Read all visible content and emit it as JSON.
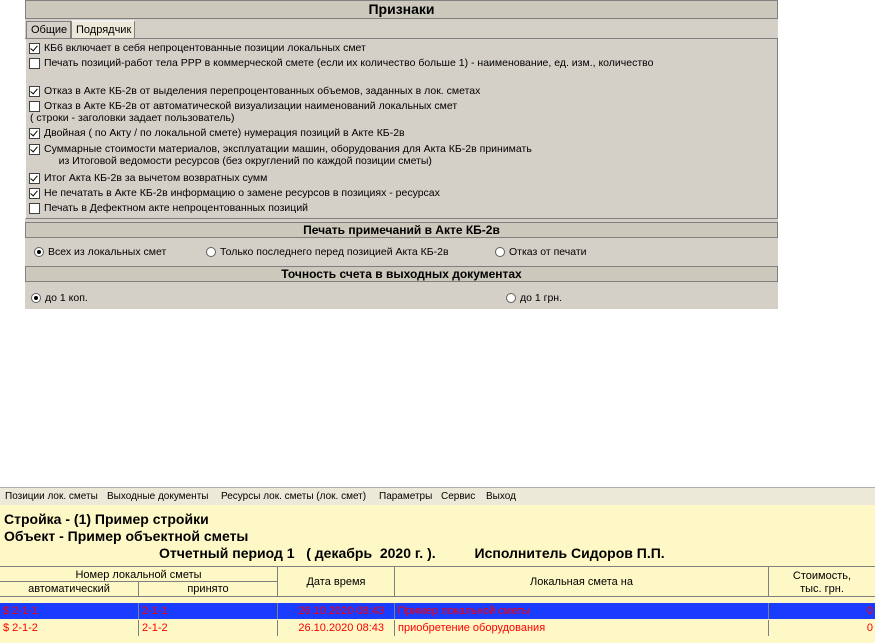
{
  "settings": {
    "title": "Признаки",
    "tabs": [
      {
        "label": "Общие",
        "selected": false
      },
      {
        "label": "Подрядчик",
        "selected": true
      }
    ],
    "options": [
      {
        "checked": true,
        "text": "КБ6 включает в себя непроцентованные позиции локальных смет",
        "sub": ""
      },
      {
        "checked": false,
        "text": "Печать позиций-работ тела РРР в коммерческой  смете (если их количество больше 1) - наименование, ед. изм., количество",
        "sub": ""
      },
      {
        "checked": true,
        "text": "Отказ в Акте КБ-2в от выделения перепроцентованных объемов, заданных в лок. сметах",
        "sub": ""
      },
      {
        "checked": false,
        "text": "Отказ в Акте КБ-2в от автоматической визуализации наименований локальных смет",
        "sub": "( строки - заголовки задает пользователь)"
      },
      {
        "checked": true,
        "text": "Двойная ( по Акту / по локальной смете) нумерация позиций в Акте КБ-2в",
        "sub": ""
      },
      {
        "checked": true,
        "text": "Суммарные стоимости материалов, эксплуатации машин, оборудования для Акта КБ-2в принимать",
        "sub": "     из Итоговой ведомости ресурсов (без округлений по каждой позиции сметы)"
      },
      {
        "checked": true,
        "text": "Итог Акта КБ-2в за вычетом возвратных сумм",
        "sub": ""
      },
      {
        "checked": true,
        "text": "Не печатать в Акте КБ-2в информацию о замене ресурсов в позициях - ресурсах",
        "sub": ""
      },
      {
        "checked": false,
        "text": "Печать в Дефектном акте непроцентованных позиций",
        "sub": ""
      }
    ],
    "notes_title": "Печать примечаний в Акте КБ-2в",
    "notes_options": [
      {
        "label": "Всех из локальных смет",
        "selected": true
      },
      {
        "label": "Только последнего перед позицией Акта КБ-2в",
        "selected": false
      },
      {
        "label": "Отказ от печати",
        "selected": false
      }
    ],
    "precision_title": "Точность счета в выходных документах",
    "precision_options": [
      {
        "label": "до 1 коп.",
        "selected": true
      },
      {
        "label": "до 1 грн.",
        "selected": false
      }
    ]
  },
  "app": {
    "menu": [
      "Позиции лок. сметы",
      "Выходные документы",
      "Ресурсы лок. сметы (лок. смет)",
      "Параметры",
      "Сервис",
      "Выход"
    ],
    "header": {
      "line1": "Стройка - (1) Пример стройки",
      "line2": "Объект - Пример объектной сметы",
      "line3": "Отчетный период 1   ( декабрь  2020 г. ).          Исполнитель Сидоров П.П."
    },
    "table": {
      "group_header": "Номер локальной сметы",
      "col_auto": "автоматический",
      "col_accepted": "принято",
      "col_datetime": "Дата время",
      "col_estimate": "Локальная смета на",
      "col_cost_line1": "Стоимость,",
      "col_cost_line2": "тыс. грн.",
      "rows": [
        {
          "auto": "$ 2-1-1",
          "accepted": "2-1-1",
          "datetime": "26.10.2020 08:43",
          "estimate": "Пример локальной сметы",
          "cost": "0",
          "selected": true
        },
        {
          "auto": "$ 2-1-2",
          "accepted": "2-1-2",
          "datetime": "26.10.2020 08:43",
          "estimate": "приобретение оборудования",
          "cost": "0",
          "selected": false
        }
      ]
    },
    "colors": {
      "row_text": "#ff0000",
      "selected_row_bg": "#1a3cff",
      "window_bg": "#fef8c6",
      "panel_bg": "#d4d0c8"
    }
  }
}
